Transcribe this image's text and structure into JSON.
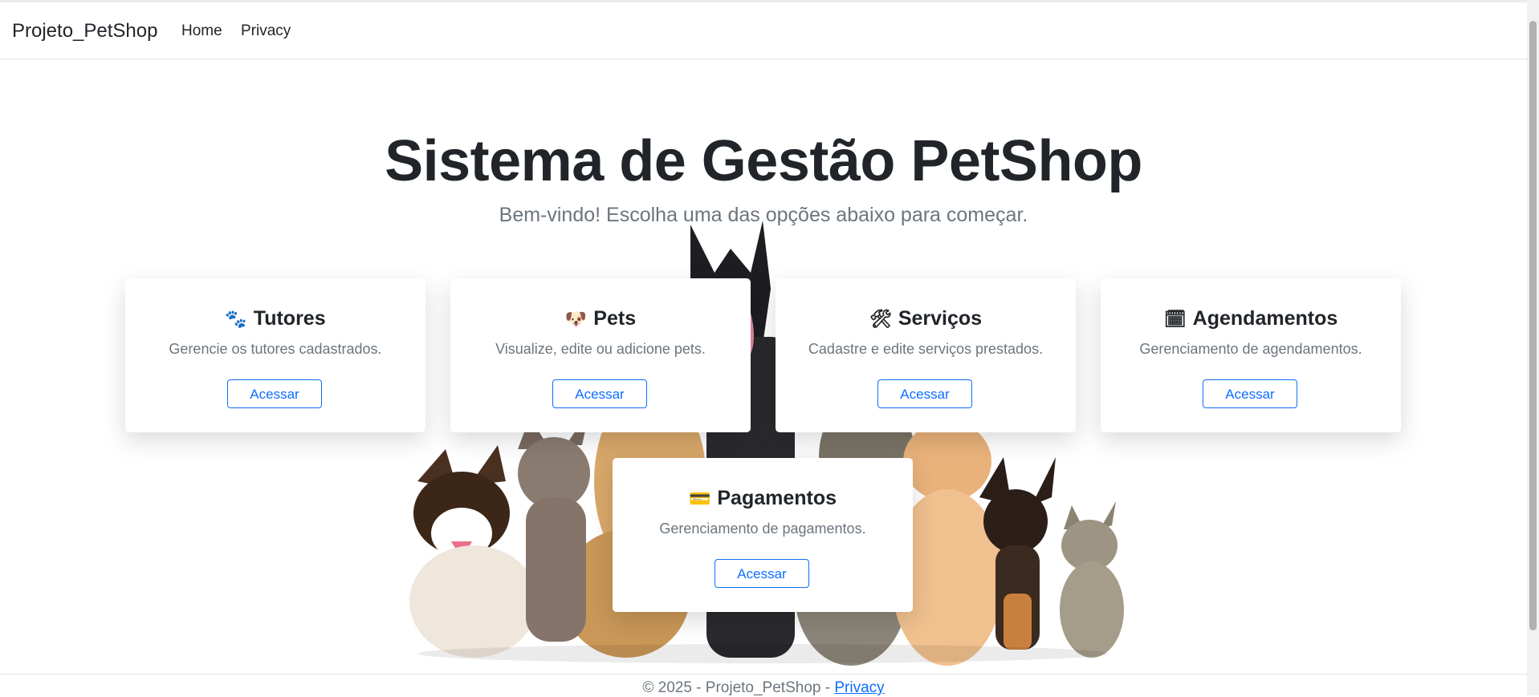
{
  "navbar": {
    "brand": "Projeto_PetShop",
    "links": [
      "Home",
      "Privacy"
    ]
  },
  "hero": {
    "title": "Sistema de Gestão PetShop",
    "subtitle": "Bem-vindo! Escolha uma das opções abaixo para começar."
  },
  "cards": [
    {
      "icon": "paw-prints-icon",
      "glyph": "🐾",
      "title": "Tutores",
      "text": "Gerencie os tutores cadastrados.",
      "button": "Acessar"
    },
    {
      "icon": "dog-face-icon",
      "glyph": "🐶",
      "title": "Pets",
      "text": "Visualize, edite ou adicione pets.",
      "button": "Acessar"
    },
    {
      "icon": "tools-icon",
      "glyph": "🛠",
      "title": "Serviços",
      "text": "Cadastre e edite serviços prestados.",
      "button": "Acessar"
    },
    {
      "icon": "calendar-icon",
      "glyph": "🗓",
      "title": "Agendamentos",
      "text": "Gerenciamento de agendamentos.",
      "button": "Acessar"
    },
    {
      "icon": "credit-card-icon",
      "glyph": "💳",
      "title": "Pagamentos",
      "text": "Gerenciamento de pagamentos.",
      "button": "Acessar"
    }
  ],
  "footer": {
    "copyright": "© 2025 - Projeto_PetShop - ",
    "link": "Privacy"
  }
}
